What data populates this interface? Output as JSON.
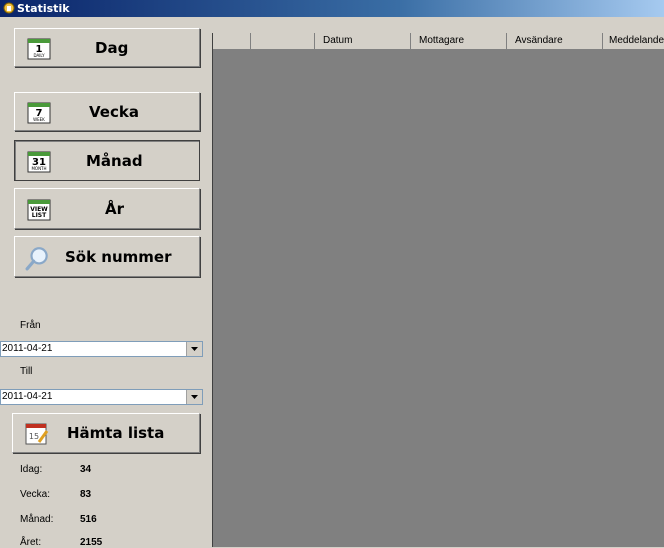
{
  "window": {
    "title": "Statistik",
    "icon": "app-icon"
  },
  "nav_buttons": [
    {
      "label": "Dag",
      "icon_text_top": "1",
      "icon_text_bottom": "DAILY"
    },
    {
      "label": "Vecka",
      "icon_text_top": "7",
      "icon_text_bottom": "WEEK"
    },
    {
      "label": "Månad",
      "icon_text_top": "31",
      "icon_text_bottom": "MONTH"
    },
    {
      "label": "År",
      "icon_text_top": "VIEW",
      "icon_text_bottom": "LIST"
    },
    {
      "label": "Sök nummer"
    }
  ],
  "from": {
    "label": "Från",
    "value": "2011-04-21"
  },
  "to": {
    "label": "Till",
    "value": "2011-04-21"
  },
  "fetch_button": {
    "label": "Hämta lista",
    "icon_text": "15"
  },
  "stats": [
    {
      "label": "Idag:",
      "value": "34"
    },
    {
      "label": "Vecka:",
      "value": "83"
    },
    {
      "label": "Månad:",
      "value": "516"
    },
    {
      "label": "Året:",
      "value": "2155"
    }
  ],
  "grid": {
    "columns": [
      "",
      "",
      "Datum",
      "Mottagare",
      "Avsändare",
      "Meddelande"
    ]
  },
  "colors": {
    "accent": "#0a246a",
    "face": "#d4d0c8",
    "grid_bg": "#808080",
    "calendar_green": "#4a9a3a"
  }
}
